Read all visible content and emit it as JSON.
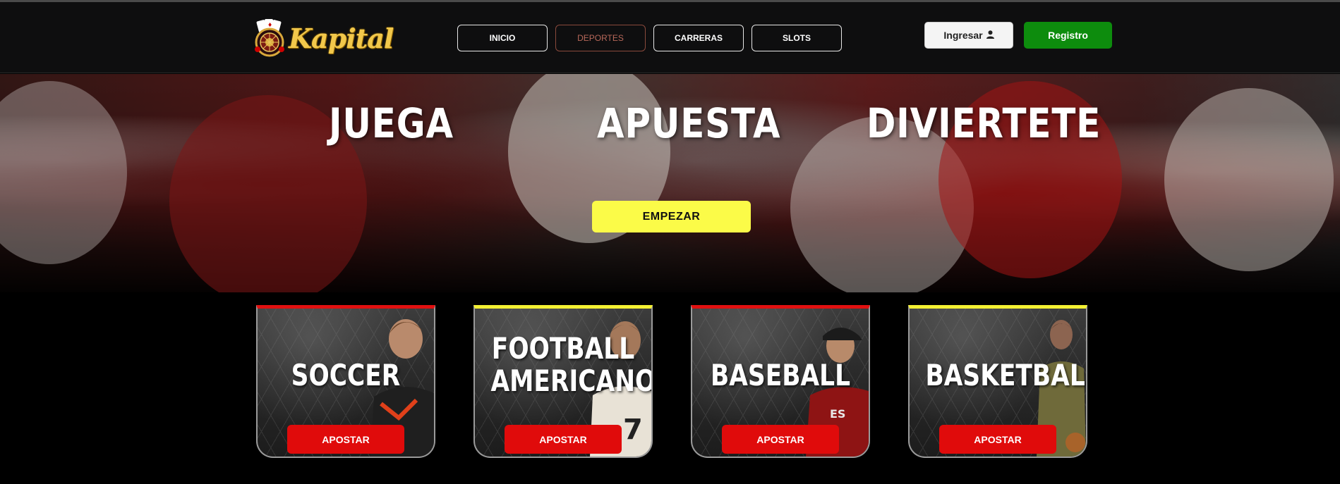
{
  "brand": {
    "name": "Kapital"
  },
  "nav": {
    "items": [
      {
        "label": "INICIO",
        "active": false
      },
      {
        "label": "DEPORTES",
        "active": true
      },
      {
        "label": "CARRERAS",
        "active": false
      },
      {
        "label": "SLOTS",
        "active": false
      }
    ]
  },
  "auth": {
    "login_label": "Ingresar",
    "login_icon": "user-icon",
    "register_label": "Registro"
  },
  "hero": {
    "words": [
      "JUEGA",
      "APUESTA",
      "DIVIERTETE"
    ],
    "cta_label": "EMPEZAR"
  },
  "cards": [
    {
      "title": "SOCCER",
      "button": "APOSTAR",
      "accent": "#e01010"
    },
    {
      "title": "FOOTBALL AMERICANO",
      "title_lines": [
        "FOOTBALL",
        "AMERICANO"
      ],
      "button": "APOSTAR",
      "accent": "#f3f032"
    },
    {
      "title": "BASEBALL",
      "button": "APOSTAR",
      "accent": "#e01010"
    },
    {
      "title": "BASKETBALL",
      "button": "APOSTAR",
      "accent": "#f3f032"
    }
  ],
  "colors": {
    "cta_yellow": "#fbfb48",
    "register_green": "#0d8c0d",
    "apostar_red": "#e00b0b",
    "logo_gold": "#f2c84b"
  }
}
